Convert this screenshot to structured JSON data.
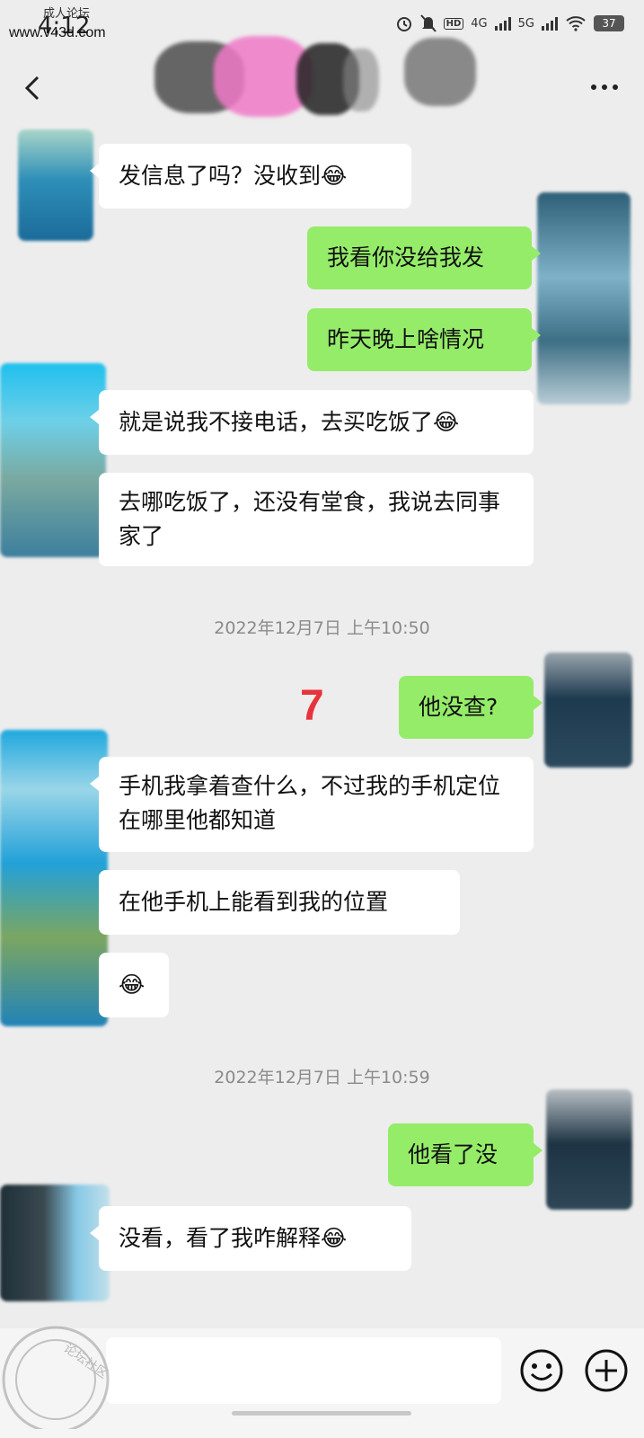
{
  "status_bar": {
    "time": "4:12",
    "watermark": "www.v43d.com",
    "watermark_small": "成人论坛",
    "net1": "4G",
    "net2": "5G",
    "hd": "HD",
    "battery": "37"
  },
  "messages": [
    {
      "side": "them",
      "text": "发信息了吗？没收到😂"
    },
    {
      "side": "me",
      "text": "我看你没给我发"
    },
    {
      "side": "me",
      "text": "昨天晚上啥情况"
    },
    {
      "side": "them",
      "text": "就是说我不接电话，去买吃饭了😂"
    },
    {
      "side": "them",
      "text": "去哪吃饭了，还没有堂食，我说去同事家了"
    },
    {
      "side": "me",
      "text": "他没查?"
    },
    {
      "side": "them",
      "text": "手机我拿着查什么，不过我的手机定位在哪里他都知道"
    },
    {
      "side": "them",
      "text": "在他手机上能看到我的位置"
    },
    {
      "side": "them",
      "text": "😂"
    },
    {
      "side": "me",
      "text": "他看了没"
    },
    {
      "side": "them",
      "text": "没看，看了我咋解释😂"
    }
  ],
  "timestamps": [
    "2022年12月7日 上午10:50",
    "2022年12月7日 上午10:59"
  ],
  "annotation": "7",
  "watermark_bottom": "论坛社区",
  "colors": {
    "bg": "#ededed",
    "mine": "#95ec69",
    "theirs": "#ffffff",
    "annotation": "#e8333a"
  },
  "icons": [
    "back-icon",
    "more-icon",
    "emoji-icon",
    "plus-icon"
  ]
}
